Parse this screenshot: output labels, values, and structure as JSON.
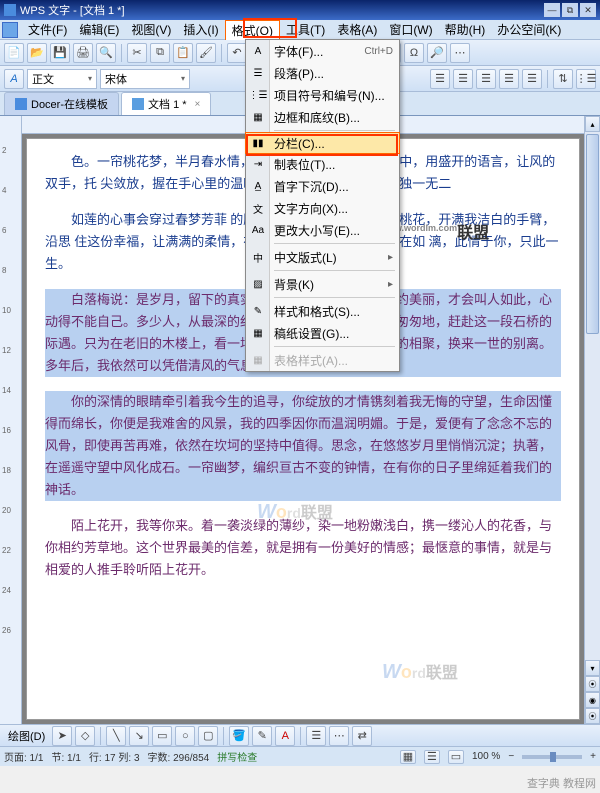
{
  "title": "WPS 文字 - [文档 1 *]",
  "menus": [
    "文件(F)",
    "编辑(E)",
    "视图(V)",
    "插入(I)",
    "格式(O)",
    "工具(T)",
    "表格(A)",
    "窗口(W)",
    "帮助(H)",
    "办公空间(K)"
  ],
  "active_menu_index": 4,
  "style_select": "正文",
  "font_select": "宋体",
  "tabs": [
    {
      "label": "Docer-在线模板",
      "active": false
    },
    {
      "label": "文档 1 *",
      "active": true
    }
  ],
  "dropdown_items": [
    {
      "label": "字体(F)...",
      "shortcut": "Ctrl+D",
      "icon": "font"
    },
    {
      "label": "段落(P)...",
      "icon": "para"
    },
    {
      "label": "项目符号和编号(N)...",
      "icon": "list"
    },
    {
      "label": "边框和底纹(B)...",
      "icon": "border"
    },
    {
      "sep": true
    },
    {
      "label": "分栏(C)...",
      "icon": "columns",
      "highlighted": true
    },
    {
      "label": "制表位(T)...",
      "icon": "tab"
    },
    {
      "label": "首字下沉(D)...",
      "icon": "dropcap"
    },
    {
      "label": "文字方向(X)...",
      "icon": "dir"
    },
    {
      "label": "更改大小写(E)...",
      "icon": "case"
    },
    {
      "sep": true
    },
    {
      "label": "中文版式(L)",
      "icon": "cn",
      "arrow": true
    },
    {
      "sep": true
    },
    {
      "label": "背景(K)",
      "icon": "bg",
      "arrow": true
    },
    {
      "sep": true
    },
    {
      "label": "样式和格式(S)...",
      "icon": "style"
    },
    {
      "label": "稿纸设置(G)...",
      "icon": "grid"
    },
    {
      "sep": true
    },
    {
      "label": "表格样式(A)...",
      "icon": "table",
      "disabled": true
    }
  ],
  "paragraphs": [
    "色。一帘桃花梦，半月春水情，                                            中，只在一朵含苞的花蕊中，用盛开的语言，让风的双手，托                                        尖敛放，握在手心里的温暖，溢出淡淡的芬芳，都成独一无二",
    "如莲的心事会穿过春梦芳菲                                            的脸上漾出的微笑，如三月的桃花，开满我洁白的手臂，沿思                                        住这份幸福，让满满的柔情，在心中弥漫……于是，心便在如                                    漓，此情于你，只此一生。",
    "白落梅说：是岁月，留下的真实痕迹，是浮世，难寻的简约美丽，才会叫人如此，心动得不能自己。多少人，从最深的红尘，脱去华服锦衣，只为匆匆地，赶赴这一段石桥的际遇。只为在老旧的木楼上，看一场消逝的雁南飞。纵算片刻的相聚，换来一世的别离。多年后，我依然可以凭借清风的气息，回味昨天的你。",
    "你的深情的眼睛牵引着我今生的追寻，你绽放的才情镌刻着我无悔的守望，生命因懂得而绵长，你便是我难舍的风景，我的四季因你而温润明媚。于是，爱便有了念念不忘的风骨，即使再苦再难，依然在坎坷的坚持中值得。思念，在悠悠岁月里悄悄沉淀；执著，在遥遥守望中风化成石。一帘幽梦，编织亘古不变的钟情，在有你的日子里绵延着我们的神话。",
    "陌上花开，我等你来。着一袭淡绿的薄纱，染一地粉嫩浅白，携一缕沁人的花香，与你相约芳草地。这个世界最美的信差，就是拥有一份美好的情感；最惬意的事情，就是与相爱的人推手聆听陌上花开。"
  ],
  "watermark": {
    "w": "W",
    "o": "o",
    "rest": "rd",
    "url": "www.wordlm.com",
    "cn": "联盟"
  },
  "vruler_nums": [
    "2",
    "4",
    "6",
    "8",
    "10",
    "12",
    "14",
    "16",
    "18",
    "20",
    "22",
    "24",
    "26"
  ],
  "draw_label": "绘图(D)",
  "status": {
    "page": "页面: 1/1",
    "sec": "节: 1/1",
    "line": "行: 17 列: 3",
    "chars": "字数: 296/854",
    "spell": "拼写检查",
    "zoom": "100 %"
  },
  "footer_wm": "查字典   教程网"
}
